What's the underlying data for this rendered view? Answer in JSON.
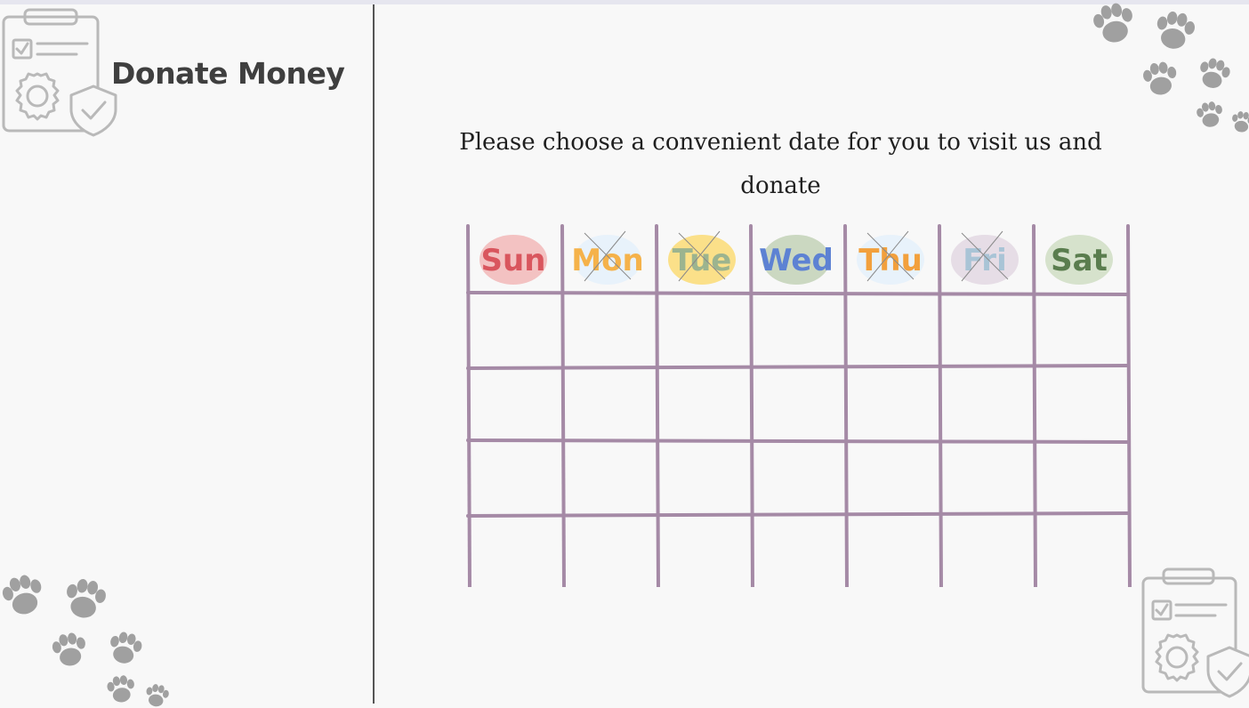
{
  "page": {
    "title": "Donate Money"
  },
  "instructions": {
    "text": "Please choose a convenient date for you to visit us and donate"
  },
  "calendar": {
    "line_color": "#a58aa6",
    "days": [
      {
        "label": "Sun",
        "text_color": "#d9565e",
        "bubble_color": "#f3c2c2",
        "available": true
      },
      {
        "label": "Mon",
        "text_color": "#f5b24a",
        "bubble_color": "#e8f2fb",
        "available": false
      },
      {
        "label": "Tue",
        "text_color": "#9cb48f",
        "bubble_color": "#fbe089",
        "available": false
      },
      {
        "label": "Wed",
        "text_color": "#5d82d3",
        "bubble_color": "#cbd8c1",
        "available": true
      },
      {
        "label": "Thu",
        "text_color": "#f2a03d",
        "bubble_color": "#e8f2fb",
        "available": false
      },
      {
        "label": "Fri",
        "text_color": "#a9c4d6",
        "bubble_color": "#e6dde6",
        "available": false
      },
      {
        "label": "Sat",
        "text_color": "#5a7d4e",
        "bubble_color": "#d6e2cc",
        "available": true
      }
    ],
    "week_rows": 4
  },
  "icons": {
    "clipboard": "clipboard-gear-shield-icon",
    "paw": "paw-print-icon"
  }
}
